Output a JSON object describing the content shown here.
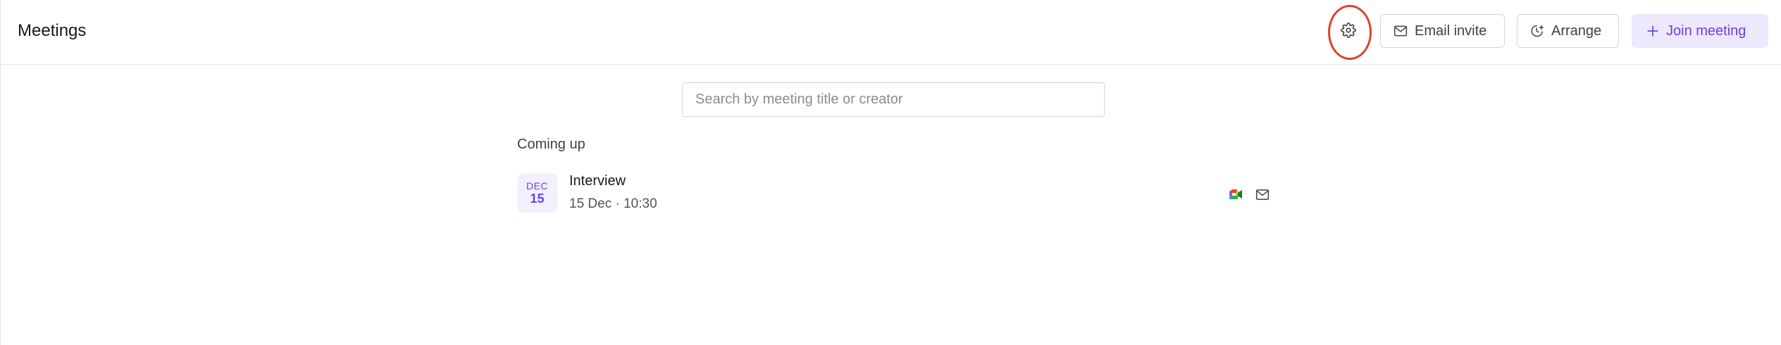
{
  "header": {
    "title": "Meetings",
    "settings_icon": "gear-icon",
    "email_invite_label": "Email invite",
    "email_invite_icon": "mail-icon",
    "arrange_label": "Arrange",
    "arrange_icon": "clock-plus-icon",
    "join_label": "Join meeting",
    "join_icon": "plus-icon"
  },
  "search": {
    "placeholder": "Search by meeting title or creator",
    "value": ""
  },
  "sections": [
    {
      "label": "Coming up",
      "meetings": [
        {
          "month": "DEC",
          "day": "15",
          "title": "Interview",
          "subtitle": "15 Dec · 10:30",
          "icons": [
            "google-meet-icon",
            "mail-icon"
          ]
        }
      ]
    }
  ],
  "colors": {
    "accent": "#6d3fe0",
    "accent_bg": "#ece8fd",
    "highlight": "#e0402a",
    "border": "#d4d4d8"
  }
}
